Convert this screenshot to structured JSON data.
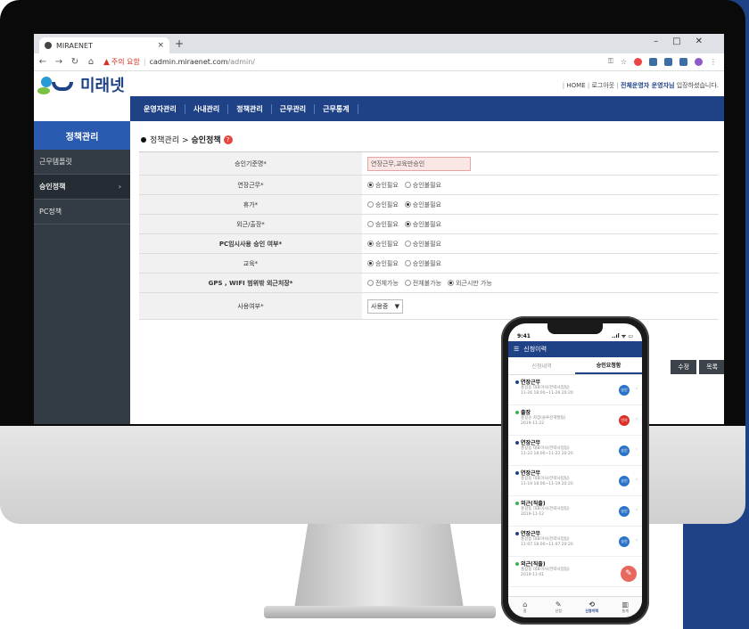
{
  "browser": {
    "tab_title": "MIRAENET",
    "tab_close": "×",
    "new_tab": "+",
    "window_controls": "–□✕",
    "security_warning": "주의 요함",
    "url_host": "cadmin.miraenet.com",
    "url_path": "/admin/"
  },
  "site": {
    "logo_text": "미래넷",
    "topnav": {
      "home": "HOME",
      "logout": "로그아웃",
      "greeting_name": "전체운영자 운영자님",
      "greeting_suffix": "입장하셨습니다."
    },
    "mainnav": [
      "운영자관리",
      "사내관리",
      "정책관리",
      "근무관리",
      "근무통계"
    ]
  },
  "sidebar": {
    "title": "정책관리",
    "items": [
      {
        "label": "근무템플릿"
      },
      {
        "label": "승인정책"
      },
      {
        "label": "PC정책"
      }
    ],
    "active_chevron": "›"
  },
  "content": {
    "breadcrumb_parent": "정책관리 >",
    "breadcrumb_current": "승인정책",
    "help_symbol": "?",
    "form": {
      "rows": [
        {
          "label": "승인기준명*",
          "input_value": "연장근무,교육만승인"
        },
        {
          "label": "연장근무*",
          "options": [
            "승인필요",
            "승인불필요"
          ]
        },
        {
          "label": "휴가*",
          "options": [
            "승인필요",
            "승인불필요"
          ]
        },
        {
          "label": "외근/출장*",
          "options": [
            "승인필요",
            "승인불필요"
          ]
        },
        {
          "label": "PC임시사용 승인 여부*",
          "options": [
            "승인필요",
            "승인불필요"
          ]
        },
        {
          "label": "교육*",
          "options": [
            "승인필요",
            "승인불필요"
          ]
        },
        {
          "label": "GPS , WIFI 범위밖 외근처장*",
          "options": [
            "전체가능",
            "전체불가능",
            "외근시만 가능"
          ]
        },
        {
          "label": "사용여부*",
          "select_value": "사용중",
          "select_arrow": "▼"
        }
      ]
    },
    "buttons": {
      "edit": "수정",
      "list": "목록"
    }
  },
  "phone": {
    "time": "9:41",
    "signal": "..ıl ᯤ ▭",
    "header_title": "신청이력",
    "menu_icon": "☰",
    "tabs": [
      "신청내역",
      "승인요청함"
    ],
    "items": [
      {
        "title": "연장근무",
        "line1": "홍길동 대표이사(전략사업팀)",
        "line2": "11-26 18:00~11-26 20:20",
        "badge": "승인"
      },
      {
        "title": "출장",
        "line1": "홍길순 차장(솔루션개발팀)",
        "line2": "2019-11-22",
        "badge": "반려"
      },
      {
        "title": "연장근무",
        "line1": "홍길동 대표이사(전략사업팀)",
        "line2": "11-22 18:00~11-22 20:20",
        "badge": "승인"
      },
      {
        "title": "연장근무",
        "line1": "홍길동 대표이사(전략사업팀)",
        "line2": "11-19 18:00~11-19 20:20",
        "badge": "승인"
      },
      {
        "title": "외근(직출)",
        "line1": "홍길동 대표이사(전략사업팀)",
        "line2": "2019-11-12",
        "badge": "승인"
      },
      {
        "title": "연장근무",
        "line1": "홍길동 대표이사(전략사업팀)",
        "line2": "11-07 18:00~11-07 20:20",
        "badge": "승인"
      },
      {
        "title": "외근(직출)",
        "line1": "홍길동 대표이사(전략사업팀)",
        "line2": "2019-11-01",
        "badge": ""
      }
    ],
    "fab_icon": "✎",
    "bottom_nav": [
      {
        "icon": "⌂",
        "label": "홈"
      },
      {
        "icon": "✎",
        "label": "신청"
      },
      {
        "icon": "⟲",
        "label": "신청이력"
      },
      {
        "icon": "▥",
        "label": "통계"
      }
    ]
  },
  "colors": {
    "brand_navy": "#1f4287",
    "sidebar_bg": "#333c44",
    "sidebar_head": "#2a5bb0",
    "approve_badge": "#2a74c8",
    "reject_badge": "#d9302a"
  }
}
